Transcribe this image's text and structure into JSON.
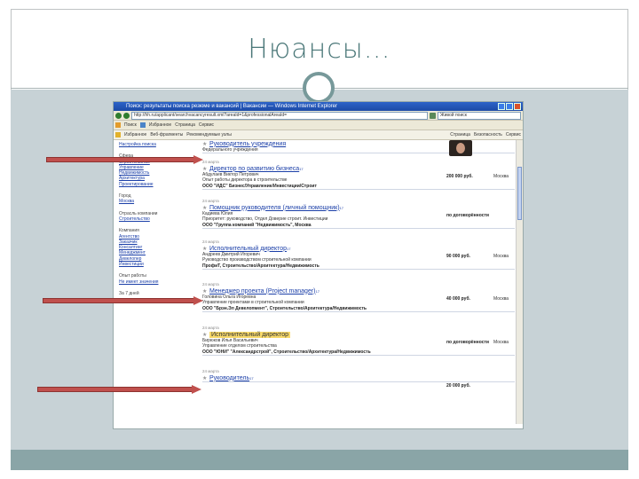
{
  "slide": {
    "title": "Нюансы…",
    "colors": {
      "accent": "#77999a",
      "panel": "#c7d2d6",
      "footer": "#8aa5a7",
      "arrow": "#c0504d"
    }
  },
  "browser": {
    "window_title": "Поиск: результаты поиска резюме и вакансий | Вакансии — Windows Internet Explorer",
    "address": "http://hh.ru/applicant/searchvacancyresult.xml?areaId=1&professionalAreaId=",
    "search_placeholder": "Живой поиск",
    "toolbar_items": [
      "Поиск",
      "Избранное",
      "Страница",
      "Сервис"
    ],
    "links_items": [
      "Избранное",
      "Веб-фрагменты",
      "Рекомендуемые узлы",
      "Страница",
      "Безопасность",
      "Сервис"
    ]
  },
  "sidebar": {
    "items": [
      "Настройка поиска",
      "",
      "Сфера",
      "Строительство",
      "Управление",
      "Недвижимость",
      "Архитектура",
      "Проектирование",
      "",
      "Город",
      "Москва",
      "",
      "Отрасль компании",
      "Строительство",
      "",
      "Компания",
      "Агентство",
      "Заказчик",
      "Консалтинг",
      "Менеджмент",
      "Девелопер",
      "Инвестиции",
      "",
      "Опыт работы",
      "Не имеет значения",
      "",
      "За 7 дней"
    ]
  },
  "vacancies": [
    {
      "date": "",
      "title": "Руководитель учреждения",
      "sup": "",
      "lines": [
        "Федерального учреждения"
      ],
      "company": "",
      "salary": "",
      "city": "",
      "photo": true
    },
    {
      "date": "24 марта",
      "title": "Директор по развитию бизнеса",
      "sup": "17",
      "lines": [
        "Абдулаев Виктор Петрович",
        "Опыт работы директора в строительстве"
      ],
      "company": "ООО \"ИДС\" Бизнес/Управление/Инвестиции/Строит",
      "salary": "200 000 руб.",
      "city": "Москва"
    },
    {
      "date": "24 марта",
      "title": "Помощник руководителя (личный помощник)",
      "sup": "17",
      "lines": [
        "Кадиева Юлия",
        "Приоритет: руководство, Отдел Доверие строит. Инвестиции"
      ],
      "company": "ООО \"Группа компаний \"Недвижимость\", Москва",
      "salary": "по договорённости",
      "city": ""
    },
    {
      "date": "24 марта",
      "title": "Исполнительный директор",
      "sup": "17",
      "lines": [
        "Андреев Дмитрий Игоревич",
        "Руководство производством строительной компании"
      ],
      "company": "ПрофиТ, Строительство/Архитектура/Недвижимость",
      "salary": "90 000 руб.",
      "city": "Москва"
    },
    {
      "date": "24 марта",
      "title": "Менеджер проекта (Project manager)",
      "sup": "17",
      "lines": [
        "Головина Ольга Игоревна",
        "Управление проектами в строительной компании"
      ],
      "company": "ООО \"Брэн.Эл Девелопмент\", Строительство/Архитектура/Недвижимость",
      "salary": "40 000 руб.",
      "city": "Москва"
    },
    {
      "date": "24 марта",
      "title": "Исполнительный директор",
      "sup": "",
      "lines": [
        "Бирюков Илья Васильевич",
        "Управление отделом строительства"
      ],
      "company": "ООО \"ЮНИ\" \"Александрстрой\", Строительство/Архитектура/Недвижимость",
      "salary": "по договорённости",
      "city": "Москва",
      "highlight": true
    },
    {
      "date": "24 марта",
      "title": "Руководитель",
      "sup": "17",
      "lines": [],
      "company": "",
      "salary": "20 000 руб.",
      "city": ""
    }
  ]
}
